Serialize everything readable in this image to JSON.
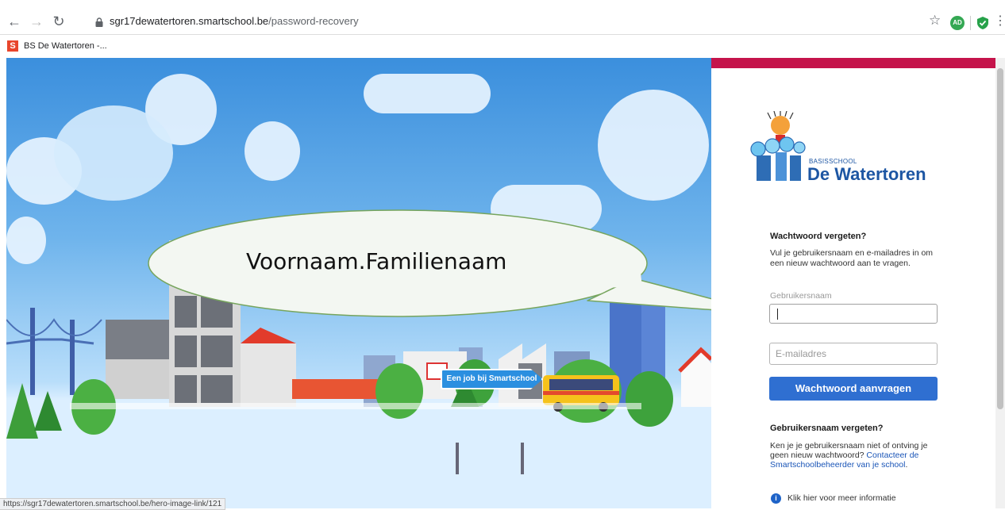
{
  "browser": {
    "url_host": "sgr17dewatertoren.smartschool.be",
    "url_path": "/password-recovery",
    "profile_initials": "AD",
    "bookmarks": [
      {
        "favicon": "S",
        "label": "BS De Watertoren -..."
      }
    ],
    "status_url": "https://sgr17dewatertoren.smartschool.be/hero-image-link/121"
  },
  "hero": {
    "sign_label": "Een job bij Smartschool",
    "bubble_text": "Voornaam.Familienaam"
  },
  "panel": {
    "school_small": "BASISSCHOOL",
    "school_name": "De Watertoren",
    "pw_title": "Wachtwoord vergeten?",
    "pw_text": "Vul je gebruikersnaam en e-mailadres in om een nieuw wachtwoord aan te vragen.",
    "username_label": "Gebruikersnaam",
    "email_placeholder": "E-mailadres",
    "submit_label": "Wachtwoord aanvragen",
    "un_title": "Gebruikersnaam vergeten?",
    "un_text": "Ken je je gebruikersnaam niet of ontving je geen nieuw wachtwoord? ",
    "un_link": "Contacteer de Smartschoolbeheerder van je school",
    "un_link_after": ".",
    "info_text": "Klik hier voor meer informatie"
  },
  "colors": {
    "brand_bar": "#c5144b",
    "button": "#2f6fd1",
    "school_blue": "#1d56a3"
  }
}
